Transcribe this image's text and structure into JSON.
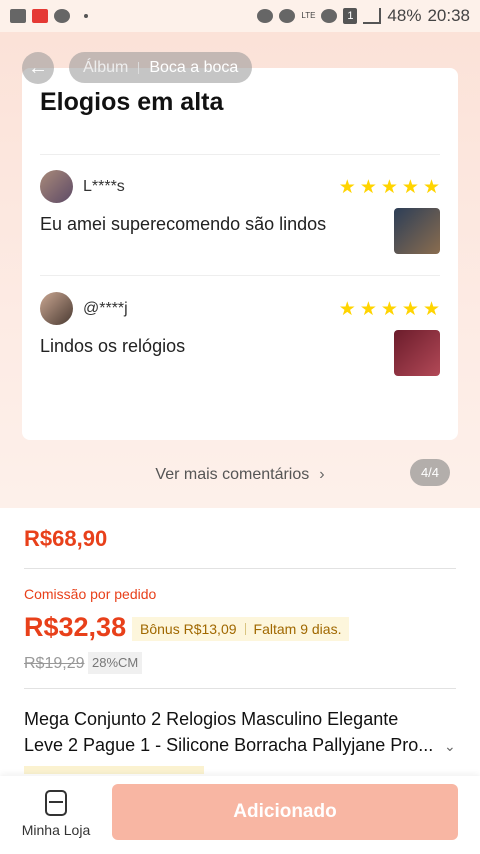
{
  "status_bar": {
    "battery": "48%",
    "time": "20:38",
    "network": "LTE",
    "sim": "1",
    "icons": [
      "gallery-icon",
      "shopee-icon",
      "messenger-icon",
      "dot-icon",
      "alarm-icon",
      "clock-icon",
      "wifi-icon",
      "signal-icon"
    ]
  },
  "header": {
    "breadcrumb": [
      "Álbum",
      "Boca a boca"
    ]
  },
  "reviews_card": {
    "title": "Elogios em alta",
    "reviews": [
      {
        "user": "L****s",
        "rating": 5,
        "text": "Eu amei superecomendo são lindos"
      },
      {
        "user": "@****j",
        "rating": 5,
        "text": "Lindos os relógios"
      }
    ]
  },
  "see_more": "Ver mais comentários",
  "pager": "4/4",
  "product": {
    "price": "R$68,90",
    "commission_label": "Comissão por pedido",
    "commission": "R$32,38",
    "bonus": "Bônus R$13,09",
    "remaining": "Faltam 9 dias.",
    "old_commission": "R$19,29",
    "commission_rate": "28%CM",
    "title_line1": "Mega Conjunto 2 Relogios Masculino Elegante",
    "title_line2": "Leve 2 Pague 1 - Silicone Borracha Pallyjane Pro..."
  },
  "bottom_bar": {
    "store_label": "Minha Loja",
    "add_label": "Adicionado"
  },
  "colors": {
    "accent": "#e8401a",
    "star": "#ffd400",
    "button": "#f8b6a3"
  }
}
